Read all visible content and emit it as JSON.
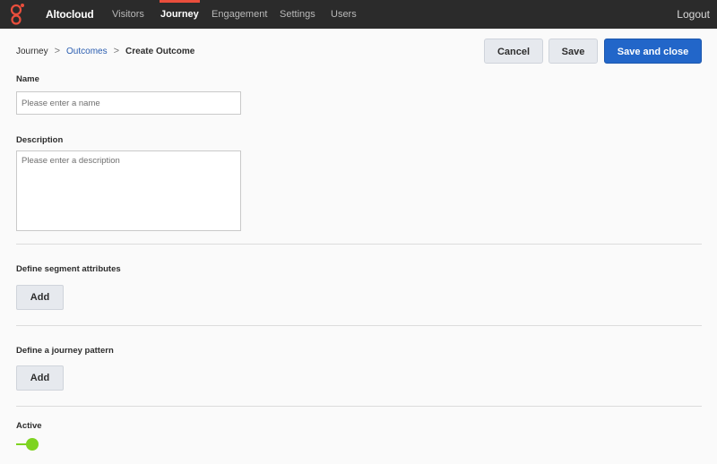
{
  "header": {
    "brand": "Altocloud",
    "nav": [
      {
        "label": "Visitors",
        "active": false
      },
      {
        "label": "Journey",
        "active": true
      },
      {
        "label": "Engagement",
        "active": false
      },
      {
        "label": "Settings",
        "active": false
      },
      {
        "label": "Users",
        "active": false
      }
    ],
    "logout_label": "Logout",
    "accent_color": "#e94e3c"
  },
  "breadcrumb": {
    "root": "Journey",
    "link": "Outcomes",
    "current": "Create Outcome",
    "separator": ">"
  },
  "actions": {
    "cancel_label": "Cancel",
    "save_label": "Save",
    "save_close_label": "Save and close",
    "primary_color": "#2266c9"
  },
  "form": {
    "name": {
      "label": "Name",
      "value": "",
      "placeholder": "Please enter a name"
    },
    "description": {
      "label": "Description",
      "value": "",
      "placeholder": "Please enter a description"
    },
    "segment": {
      "label": "Define segment attributes",
      "button_label": "Add"
    },
    "journey": {
      "label": "Define a journey pattern",
      "button_label": "Add"
    },
    "active": {
      "label": "Active",
      "enabled": true,
      "toggle_color": "#7ed321"
    }
  }
}
